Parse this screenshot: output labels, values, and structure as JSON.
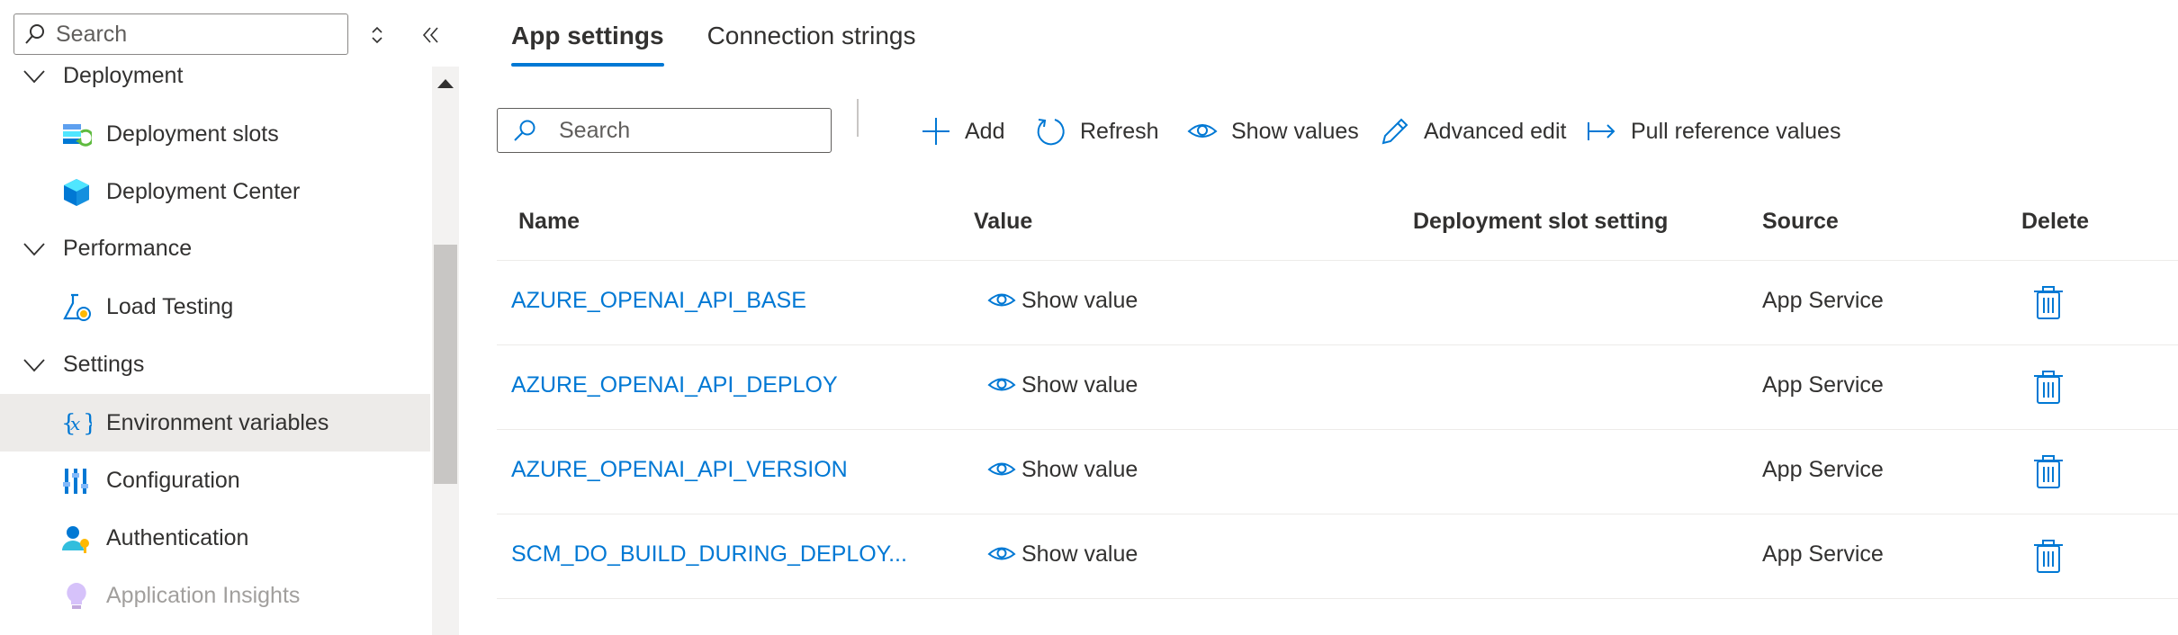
{
  "sidebar": {
    "search_placeholder": "Search",
    "items": [
      {
        "type": "group",
        "label": "Deployment",
        "icon": "chevron-down-icon"
      },
      {
        "type": "item",
        "label": "Deployment slots",
        "icon": "deployment-slots-icon"
      },
      {
        "type": "item",
        "label": "Deployment Center",
        "icon": "deployment-center-icon"
      },
      {
        "type": "group",
        "label": "Performance",
        "icon": "chevron-down-icon"
      },
      {
        "type": "item",
        "label": "Load Testing",
        "icon": "load-testing-icon"
      },
      {
        "type": "group",
        "label": "Settings",
        "icon": "chevron-down-icon"
      },
      {
        "type": "item",
        "label": "Environment variables",
        "icon": "environment-variables-icon",
        "selected": true
      },
      {
        "type": "item",
        "label": "Configuration",
        "icon": "configuration-icon"
      },
      {
        "type": "item",
        "label": "Authentication",
        "icon": "authentication-icon"
      },
      {
        "type": "item",
        "label": "Application Insights",
        "icon": "application-insights-icon",
        "disabled": true
      }
    ]
  },
  "tabs": [
    {
      "label": "App settings",
      "active": true
    },
    {
      "label": "Connection strings",
      "active": false
    }
  ],
  "toolbar": {
    "search_placeholder": "Search",
    "add_label": "Add",
    "refresh_label": "Refresh",
    "show_values_label": "Show values",
    "advanced_edit_label": "Advanced edit",
    "pull_reference_label": "Pull reference values"
  },
  "table": {
    "columns": {
      "name": "Name",
      "value": "Value",
      "slot": "Deployment slot setting",
      "source": "Source",
      "delete": "Delete"
    },
    "rows": [
      {
        "name": "AZURE_OPENAI_API_BASE",
        "value_label": "Show value",
        "source": "App Service"
      },
      {
        "name": "AZURE_OPENAI_API_DEPLOY",
        "value_label": "Show value",
        "source": "App Service"
      },
      {
        "name": "AZURE_OPENAI_API_VERSION",
        "value_label": "Show value",
        "source": "App Service"
      },
      {
        "name": "SCM_DO_BUILD_DURING_DEPLOY...",
        "value_label": "Show value",
        "source": "App Service"
      }
    ]
  },
  "colors": {
    "accent": "#0078d4",
    "selected_bg": "#edebe9",
    "text": "#323130",
    "muted_text": "#a19f9d"
  }
}
